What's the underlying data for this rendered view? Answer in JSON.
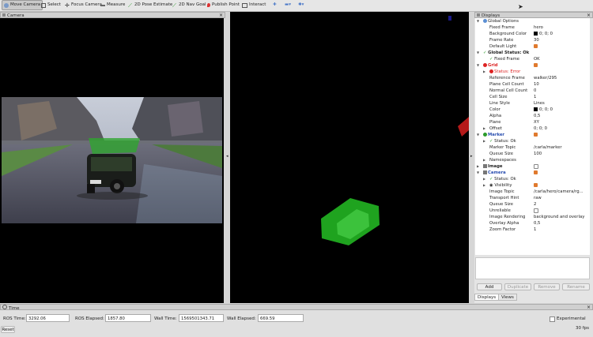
{
  "toolbar": {
    "items": [
      {
        "label": "Move Camera",
        "icon": "move-camera-icon"
      },
      {
        "label": "Select",
        "icon": "select-icon"
      },
      {
        "label": "Focus Camera",
        "icon": "focus-camera-icon"
      },
      {
        "label": "Measure",
        "icon": "measure-icon"
      },
      {
        "label": "2D Pose Estimate",
        "icon": "pose-estimate-icon"
      },
      {
        "label": "2D Nav Goal",
        "icon": "nav-goal-icon"
      },
      {
        "label": "Publish Point",
        "icon": "publish-point-icon"
      },
      {
        "label": "Interact",
        "icon": "interact-icon"
      }
    ]
  },
  "camera_panel": {
    "title": "Camera",
    "close": "×"
  },
  "displays_panel": {
    "title": "Displays",
    "close": "×",
    "rows": [
      {
        "label": "Global Options",
        "value": ""
      },
      {
        "label": "Fixed Frame",
        "value": "hero"
      },
      {
        "label": "Background Color",
        "value": "0; 0; 0"
      },
      {
        "label": "Frame Rate",
        "value": "30"
      },
      {
        "label": "Default Light",
        "value": ""
      },
      {
        "label": "Global Status: Ok",
        "value": ""
      },
      {
        "label": "Fixed Frame",
        "value": "OK"
      },
      {
        "label": "Grid",
        "value": ""
      },
      {
        "label": "Status: Error",
        "value": ""
      },
      {
        "label": "Reference Frame",
        "value": "walker/295"
      },
      {
        "label": "Plane Cell Count",
        "value": "10"
      },
      {
        "label": "Normal Cell Count",
        "value": "0"
      },
      {
        "label": "Cell Size",
        "value": "1"
      },
      {
        "label": "Line Style",
        "value": "Lines"
      },
      {
        "label": "Color",
        "value": "0; 0; 0"
      },
      {
        "label": "Alpha",
        "value": "0,5"
      },
      {
        "label": "Plane",
        "value": "XY"
      },
      {
        "label": "Offset",
        "value": "0; 0; 0"
      },
      {
        "label": "Marker",
        "value": ""
      },
      {
        "label": "Status: Ok",
        "value": ""
      },
      {
        "label": "Marker Topic",
        "value": "/carla/marker"
      },
      {
        "label": "Queue Size",
        "value": "100"
      },
      {
        "label": "Namespaces",
        "value": ""
      },
      {
        "label": "Image",
        "value": ""
      },
      {
        "label": "Camera",
        "value": ""
      },
      {
        "label": "Status: Ok",
        "value": ""
      },
      {
        "label": "Visibility",
        "value": ""
      },
      {
        "label": "Image Topic",
        "value": "/carla/hero/camera/rg..."
      },
      {
        "label": "Transport Hint",
        "value": "raw"
      },
      {
        "label": "Queue Size",
        "value": "2"
      },
      {
        "label": "Unreliable",
        "value": ""
      },
      {
        "label": "Image Rendering",
        "value": "background and overlay"
      },
      {
        "label": "Overlay Alpha",
        "value": "0,5"
      },
      {
        "label": "Zoom Factor",
        "value": "1"
      }
    ],
    "buttons": {
      "add": "Add",
      "duplicate": "Duplicate",
      "remove": "Remove",
      "rename": "Rename"
    },
    "tabs": {
      "displays": "Displays",
      "views": "Views"
    }
  },
  "time_panel": {
    "title": "Time",
    "ros_time_label": "ROS Time:",
    "ros_time": "3292.06",
    "ros_elapsed_label": "ROS Elapsed:",
    "ros_elapsed": "1857.80",
    "wall_time_label": "Wall Time:",
    "wall_time": "1569501343.71",
    "wall_elapsed_label": "Wall Elapsed:",
    "wall_elapsed": "669.59",
    "experimental": "Experimental",
    "reset": "Reset",
    "fps": "30 fps"
  },
  "colors": {
    "accent": "#e07a2e",
    "ok": "#2a9a2a",
    "error": "#dd2222",
    "marker": "#1fa31f"
  }
}
